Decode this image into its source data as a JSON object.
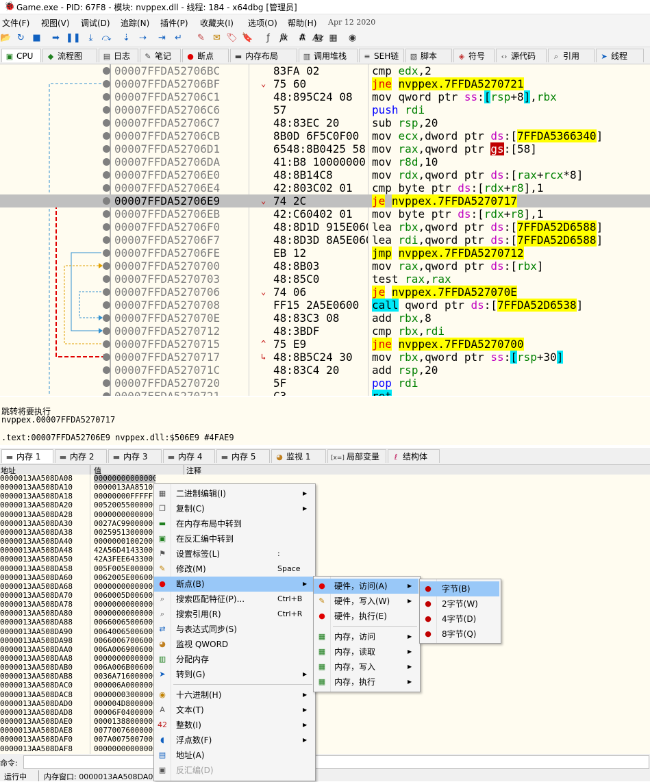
{
  "titlebar": {
    "title": "Game.exe - PID: 67F8 - 模块: nvppex.dll - 线程: 184 - x64dbg [管理员]"
  },
  "menubar": {
    "items": [
      "文件(F)",
      "视图(V)",
      "调试(D)",
      "追踪(N)",
      "插件(P)",
      "收藏夹(I)",
      "选项(O)",
      "帮助(H)"
    ],
    "date": "Apr 12 2020"
  },
  "toolbar": {
    "icons": [
      "open-icon",
      "restart-icon",
      "stop-icon",
      "run-icon",
      "pause-icon",
      "step-into-icon",
      "step-over-icon",
      "trace-into-icon",
      "trace-over-icon",
      "run-to-user-icon",
      "run-to-return-icon",
      "patch-icon",
      "comment-icon",
      "label-icon",
      "bookmark-icon",
      "function-icon",
      "hash-icon",
      "text-icon",
      "script-icon",
      "calculator-icon",
      "help-icon"
    ],
    "text_buttons": [
      "fx",
      "#",
      "Az"
    ]
  },
  "tabs": [
    {
      "label": "CPU",
      "icon": "cpu-icon"
    },
    {
      "label": "流程图",
      "icon": "graph-icon"
    },
    {
      "label": "日志",
      "icon": "log-icon"
    },
    {
      "label": "笔记",
      "icon": "notes-icon"
    },
    {
      "label": "断点",
      "icon": "breakpoint-icon"
    },
    {
      "label": "内存布局",
      "icon": "memory-map-icon"
    },
    {
      "label": "调用堆栈",
      "icon": "call-stack-icon"
    },
    {
      "label": "SEH链",
      "icon": "seh-icon"
    },
    {
      "label": "脚本",
      "icon": "script-tab-icon"
    },
    {
      "label": "符号",
      "icon": "symbol-icon"
    },
    {
      "label": "源代码",
      "icon": "source-icon"
    },
    {
      "label": "引用",
      "icon": "reference-icon"
    },
    {
      "label": "线程",
      "icon": "thread-icon"
    }
  ],
  "disasm": {
    "rows": [
      {
        "addr": "00007FFDA52706BC",
        "bytes": "83FA 02",
        "mn": "cmp",
        "ops": [
          [
            "reg",
            "edx"
          ],
          [
            "n",
            ","
          ],
          [
            "n",
            "2"
          ]
        ]
      },
      {
        "addr": "00007FFDA52706BF",
        "arrow": "⌄",
        "bytes": "75 60",
        "mn": "jne",
        "ops": [
          [
            "hl",
            "nvppex.7FFDA5270721"
          ]
        ]
      },
      {
        "addr": "00007FFDA52706C1",
        "bytes": "48:895C24 08",
        "mn": "mov",
        "ops": [
          [
            "n",
            "qword ptr "
          ],
          [
            "seg",
            "ss"
          ],
          [
            "n",
            ":"
          ],
          [
            "bkt",
            "["
          ],
          [
            "reg",
            "rsp"
          ],
          [
            "n",
            "+"
          ],
          [
            "n",
            "8"
          ],
          [
            "bkt",
            "]"
          ],
          [
            "n",
            ","
          ],
          [
            "reg",
            "rbx"
          ]
        ]
      },
      {
        "addr": "00007FFDA52706C6",
        "bytes": "57",
        "mn": "push",
        "ops": [
          [
            "reg",
            "rdi"
          ]
        ]
      },
      {
        "addr": "00007FFDA52706C7",
        "bytes": "48:83EC 20",
        "mn": "sub",
        "ops": [
          [
            "reg",
            "rsp"
          ],
          [
            "n",
            ","
          ],
          [
            "n",
            "20"
          ]
        ]
      },
      {
        "addr": "00007FFDA52706CB",
        "bytes": "8B0D 6F5C0F00",
        "mn": "mov",
        "ops": [
          [
            "reg",
            "ecx"
          ],
          [
            "n",
            ","
          ],
          [
            "n",
            "dword ptr "
          ],
          [
            "seg",
            "ds"
          ],
          [
            "n",
            ":"
          ],
          [
            "n",
            "["
          ],
          [
            "hl",
            "7FFDA5366340"
          ],
          [
            "n",
            "]"
          ]
        ]
      },
      {
        "addr": "00007FFDA52706D1",
        "bytes": "6548:8B0425 58",
        "mn": "mov",
        "ops": [
          [
            "reg",
            "rax"
          ],
          [
            "n",
            ","
          ],
          [
            "n",
            "qword ptr "
          ],
          [
            "gs",
            "gs"
          ],
          [
            "n",
            ":"
          ],
          [
            "n",
            "[58]"
          ]
        ]
      },
      {
        "addr": "00007FFDA52706DA",
        "bytes": "41:B8 10000000",
        "mn": "mov",
        "ops": [
          [
            "reg",
            "r8d"
          ],
          [
            "n",
            ","
          ],
          [
            "n",
            "10"
          ]
        ]
      },
      {
        "addr": "00007FFDA52706E0",
        "bytes": "48:8B14C8",
        "mn": "mov",
        "ops": [
          [
            "reg",
            "rdx"
          ],
          [
            "n",
            ","
          ],
          [
            "n",
            "qword ptr "
          ],
          [
            "seg",
            "ds"
          ],
          [
            "n",
            ":"
          ],
          [
            "n",
            "["
          ],
          [
            "reg",
            "rax"
          ],
          [
            "n",
            "+"
          ],
          [
            "reg",
            "rcx"
          ],
          [
            "n",
            "*8]"
          ]
        ]
      },
      {
        "addr": "00007FFDA52706E4",
        "bytes": "42:803C02 01",
        "mn": "cmp",
        "ops": [
          [
            "n",
            "byte ptr "
          ],
          [
            "seg",
            "ds"
          ],
          [
            "n",
            ":"
          ],
          [
            "n",
            "["
          ],
          [
            "reg",
            "rdx"
          ],
          [
            "n",
            "+"
          ],
          [
            "reg",
            "r8"
          ],
          [
            "n",
            "],1"
          ]
        ]
      },
      {
        "addr": "00007FFDA52706E9",
        "arrow": "⌄",
        "bytes": "74 2C",
        "mn": "je",
        "ops": [
          [
            "hl",
            "nvppex.7FFDA5270717"
          ]
        ],
        "sel": true
      },
      {
        "addr": "00007FFDA52706EB",
        "bytes": "42:C60402 01",
        "mn": "mov",
        "ops": [
          [
            "n",
            "byte ptr "
          ],
          [
            "seg",
            "ds"
          ],
          [
            "n",
            ":"
          ],
          [
            "n",
            "["
          ],
          [
            "reg",
            "rdx"
          ],
          [
            "n",
            "+"
          ],
          [
            "reg",
            "r8"
          ],
          [
            "n",
            "],1"
          ]
        ]
      },
      {
        "addr": "00007FFDA52706F0",
        "bytes": "48:8D1D 915E0600",
        "mn": "lea",
        "ops": [
          [
            "reg",
            "rbx"
          ],
          [
            "n",
            ","
          ],
          [
            "n",
            "qword ptr "
          ],
          [
            "seg",
            "ds"
          ],
          [
            "n",
            ":"
          ],
          [
            "n",
            "["
          ],
          [
            "hl",
            "7FFDA52D6588"
          ],
          [
            "n",
            "]"
          ]
        ]
      },
      {
        "addr": "00007FFDA52706F7",
        "bytes": "48:8D3D 8A5E0600",
        "mn": "lea",
        "ops": [
          [
            "reg",
            "rdi"
          ],
          [
            "n",
            ","
          ],
          [
            "n",
            "qword ptr "
          ],
          [
            "seg",
            "ds"
          ],
          [
            "n",
            ":"
          ],
          [
            "n",
            "["
          ],
          [
            "hl",
            "7FFDA52D6588"
          ],
          [
            "n",
            "]"
          ]
        ]
      },
      {
        "addr": "00007FFDA52706FE",
        "bytes": "EB 12",
        "mn": "jmp",
        "ops": [
          [
            "hl",
            "nvppex.7FFDA5270712"
          ]
        ]
      },
      {
        "addr": "00007FFDA5270700",
        "bytes": "48:8B03",
        "mn": "mov",
        "ops": [
          [
            "reg",
            "rax"
          ],
          [
            "n",
            ","
          ],
          [
            "n",
            "qword ptr "
          ],
          [
            "seg",
            "ds"
          ],
          [
            "n",
            ":"
          ],
          [
            "n",
            "["
          ],
          [
            "reg",
            "rbx"
          ],
          [
            "n",
            "]"
          ]
        ]
      },
      {
        "addr": "00007FFDA5270703",
        "bytes": "48:85C0",
        "mn": "test",
        "ops": [
          [
            "reg",
            "rax"
          ],
          [
            "n",
            ","
          ],
          [
            "reg",
            "rax"
          ]
        ]
      },
      {
        "addr": "00007FFDA5270706",
        "arrow": "⌄",
        "bytes": "74 06",
        "mn": "je",
        "ops": [
          [
            "hl",
            "nvppex.7FFDA527070E"
          ]
        ]
      },
      {
        "addr": "00007FFDA5270708",
        "bytes": "FF15 2A5E0600",
        "mn": "call",
        "ops": [
          [
            "n",
            "qword ptr "
          ],
          [
            "seg",
            "ds"
          ],
          [
            "n",
            ":"
          ],
          [
            "n",
            "["
          ],
          [
            "hl",
            "7FFDA52D6538"
          ],
          [
            "n",
            "]"
          ]
        ]
      },
      {
        "addr": "00007FFDA527070E",
        "bytes": "48:83C3 08",
        "mn": "add",
        "ops": [
          [
            "reg",
            "rbx"
          ],
          [
            "n",
            ","
          ],
          [
            "n",
            "8"
          ]
        ]
      },
      {
        "addr": "00007FFDA5270712",
        "bytes": "48:3BDF",
        "mn": "cmp",
        "ops": [
          [
            "reg",
            "rbx"
          ],
          [
            "n",
            ","
          ],
          [
            "reg",
            "rdi"
          ]
        ]
      },
      {
        "addr": "00007FFDA5270715",
        "arrow": "^",
        "bytes": "75 E9",
        "mn": "jne",
        "ops": [
          [
            "hl",
            "nvppex.7FFDA5270700"
          ]
        ]
      },
      {
        "addr": "00007FFDA5270717",
        "arrow": "↳",
        "bytes": "48:8B5C24 30",
        "mn": "mov",
        "ops": [
          [
            "reg",
            "rbx"
          ],
          [
            "n",
            ","
          ],
          [
            "n",
            "qword ptr "
          ],
          [
            "seg",
            "ss"
          ],
          [
            "n",
            ":"
          ],
          [
            "bkt",
            "["
          ],
          [
            "reg",
            "rsp"
          ],
          [
            "n",
            "+"
          ],
          [
            "n",
            "30"
          ],
          [
            "bkt",
            "]"
          ]
        ]
      },
      {
        "addr": "00007FFDA527071C",
        "bytes": "48:83C4 20",
        "mn": "add",
        "ops": [
          [
            "reg",
            "rsp"
          ],
          [
            "n",
            ","
          ],
          [
            "n",
            "20"
          ]
        ]
      },
      {
        "addr": "00007FFDA5270720",
        "bytes": "5F",
        "mn": "pop",
        "ops": [
          [
            "reg",
            "rdi"
          ]
        ]
      },
      {
        "addr": "00007FFDA5270721",
        "bytes": "C3",
        "mn": "ret",
        "ops": []
      }
    ]
  },
  "info": {
    "line1": "跳转将要执行",
    "line2": "nvppex.00007FFDA5270717",
    "line3": ".text:00007FFDA52706E9 nvppex.dll:$506E9 #4FAE9"
  },
  "memtabs": [
    {
      "label": "内存 1",
      "icon": "memory-tab-icon"
    },
    {
      "label": "内存 2",
      "icon": "memory-tab-icon"
    },
    {
      "label": "内存 3",
      "icon": "memory-tab-icon"
    },
    {
      "label": "内存 4",
      "icon": "memory-tab-icon"
    },
    {
      "label": "内存 5",
      "icon": "memory-tab-icon"
    },
    {
      "label": "监视 1",
      "icon": "watch-icon"
    },
    {
      "label": "局部变量",
      "icon": "locals-icon"
    },
    {
      "label": "结构体",
      "icon": "struct-icon"
    }
  ],
  "memhead": {
    "addr": "地址",
    "value": "值",
    "comment": "注释"
  },
  "memdump": {
    "rows": [
      {
        "a": "0000013AA508DA08",
        "v": "0000000000000000"
      },
      {
        "a": "0000013AA508DA10",
        "v": "0000013AA8510000"
      },
      {
        "a": "0000013AA508DA18",
        "v": "00000000FFFFFFFF"
      },
      {
        "a": "0000013AA508DA20",
        "v": "0052005500000000"
      },
      {
        "a": "0000013AA508DA28",
        "v": "0000000000000000"
      },
      {
        "a": "0000013AA508DA30",
        "v": "0027AC9900000000"
      },
      {
        "a": "0000013AA508DA38",
        "v": "0025951300000000"
      },
      {
        "a": "0000013AA508DA40",
        "v": "0000000100200000"
      },
      {
        "a": "0000013AA508DA48",
        "v": "42A56D4143300000"
      },
      {
        "a": "0000013AA508DA50",
        "v": "42A3FEE643300000"
      },
      {
        "a": "0000013AA508DA58",
        "v": "005F005E00000000"
      },
      {
        "a": "0000013AA508DA60",
        "v": "0062005E00600000"
      },
      {
        "a": "0000013AA508DA68",
        "v": "0000000000000000"
      },
      {
        "a": "0000013AA508DA70",
        "v": "0060005D00600000"
      },
      {
        "a": "0000013AA508DA78",
        "v": "0000000000000000"
      },
      {
        "a": "0000013AA508DA80",
        "v": "0000000000000000"
      },
      {
        "a": "0000013AA508DA88",
        "v": "0066006500600000"
      },
      {
        "a": "0000013AA508DA90",
        "v": "0064006500600000"
      },
      {
        "a": "0000013AA508DA98",
        "v": "0066006700600000"
      },
      {
        "a": "0000013AA508DAA0",
        "v": "006A006900600000"
      },
      {
        "a": "0000013AA508DAA8",
        "v": "0000000000000000"
      },
      {
        "a": "0000013AA508DAB0",
        "v": "006A006B00600000"
      },
      {
        "a": "0000013AA508DAB8",
        "v": "0036A71600000000"
      },
      {
        "a": "0000013AA508DAC0",
        "v": "000006A000000000"
      },
      {
        "a": "0000013AA508DAC8",
        "v": "0000000300000000"
      },
      {
        "a": "0000013AA508DAD0",
        "v": "000004D800000000"
      },
      {
        "a": "0000013AA508DAD8",
        "v": "00006F0400000000"
      },
      {
        "a": "0000013AA508DAE0",
        "v": "0000138800000000"
      },
      {
        "a": "0000013AA508DAE8",
        "v": "0077007600000000"
      },
      {
        "a": "0000013AA508DAF0",
        "v": "007A007500700000"
      },
      {
        "a": "0000013AA508DAF8",
        "v": "0000000000000000"
      }
    ]
  },
  "ctx_main": {
    "items": [
      {
        "icon": "binary-icon",
        "label": "二进制编辑(I)",
        "sub": true
      },
      {
        "icon": "copy-icon",
        "label": "复制(C)",
        "sub": true
      },
      {
        "icon": "memory-map-goto-icon",
        "label": "在内存布局中转到"
      },
      {
        "icon": "disasm-goto-icon",
        "label": "在反汇编中转到"
      },
      {
        "icon": "label-set-icon",
        "label": "设置标签(L)",
        "shortcut": ":"
      },
      {
        "icon": "modify-icon",
        "label": "修改(M)",
        "shortcut": "Space"
      },
      {
        "icon": "breakpoint-menu-icon",
        "label": "断点(B)",
        "sub": true,
        "hot": true
      },
      {
        "icon": "pattern-icon",
        "label": "搜索匹配特征(P)...",
        "shortcut": "Ctrl+B"
      },
      {
        "icon": "search-ref-icon",
        "label": "搜索引用(R)",
        "shortcut": "Ctrl+R"
      },
      {
        "icon": "sync-icon",
        "label": "与表达式同步(S)"
      },
      {
        "icon": "watch-menu-icon",
        "label": "监视 QWORD"
      },
      {
        "icon": "alloc-icon",
        "label": "分配内存"
      },
      {
        "icon": "goto-icon",
        "label": "转到(G)",
        "sub": true
      },
      {
        "icon": "hex-icon",
        "label": "十六进制(H)",
        "sub": true,
        "sep_before": true
      },
      {
        "icon": "text-mode-icon",
        "label": "文本(T)",
        "sub": true
      },
      {
        "icon": "integer-icon",
        "label": "整数(I)",
        "sub": true
      },
      {
        "icon": "float-icon",
        "label": "浮点数(F)",
        "sub": true
      },
      {
        "icon": "address-icon",
        "label": "地址(A)"
      },
      {
        "icon": "disasm-mode-icon",
        "label": "反汇编(D)",
        "disabled": true
      }
    ]
  },
  "ctx_bp": {
    "items": [
      {
        "icon": "hw-access-icon",
        "label": "硬件，访问(A)",
        "sub": true,
        "hot": true
      },
      {
        "icon": "hw-write-icon",
        "label": "硬件，写入(W)",
        "sub": true
      },
      {
        "icon": "hw-exec-icon",
        "label": "硬件，执行(E)"
      },
      {
        "icon": "mem-access-icon",
        "label": "内存，访问",
        "sub": true,
        "sep_before": true
      },
      {
        "icon": "mem-read-icon",
        "label": "内存，读取",
        "sub": true
      },
      {
        "icon": "mem-write-icon",
        "label": "内存，写入",
        "sub": true
      },
      {
        "icon": "mem-exec-icon",
        "label": "内存，执行",
        "sub": true
      }
    ]
  },
  "ctx_size": {
    "items": [
      {
        "icon": "byte-icon",
        "label": "字节(B)",
        "hot": true
      },
      {
        "icon": "word-icon",
        "label": "2字节(W)"
      },
      {
        "icon": "dword-icon",
        "label": "4字节(D)"
      },
      {
        "icon": "qword-icon",
        "label": "8字节(Q)"
      }
    ]
  },
  "cmdbar": {
    "label": "命令:"
  },
  "statusbar": {
    "state": "运行中",
    "memwin": "内存窗口: 0000013AA508DA08"
  },
  "colors": {
    "jump_arrow_red": "#e00000",
    "jump_arrow_blue": "#3090d0",
    "jump_arrow_orange": "#e0a000",
    "highlight_yellow": "#ffff00",
    "call_cyan": "#00e8f8",
    "selection": "#c0c0c0",
    "menu_hot": "#99c8f8"
  }
}
